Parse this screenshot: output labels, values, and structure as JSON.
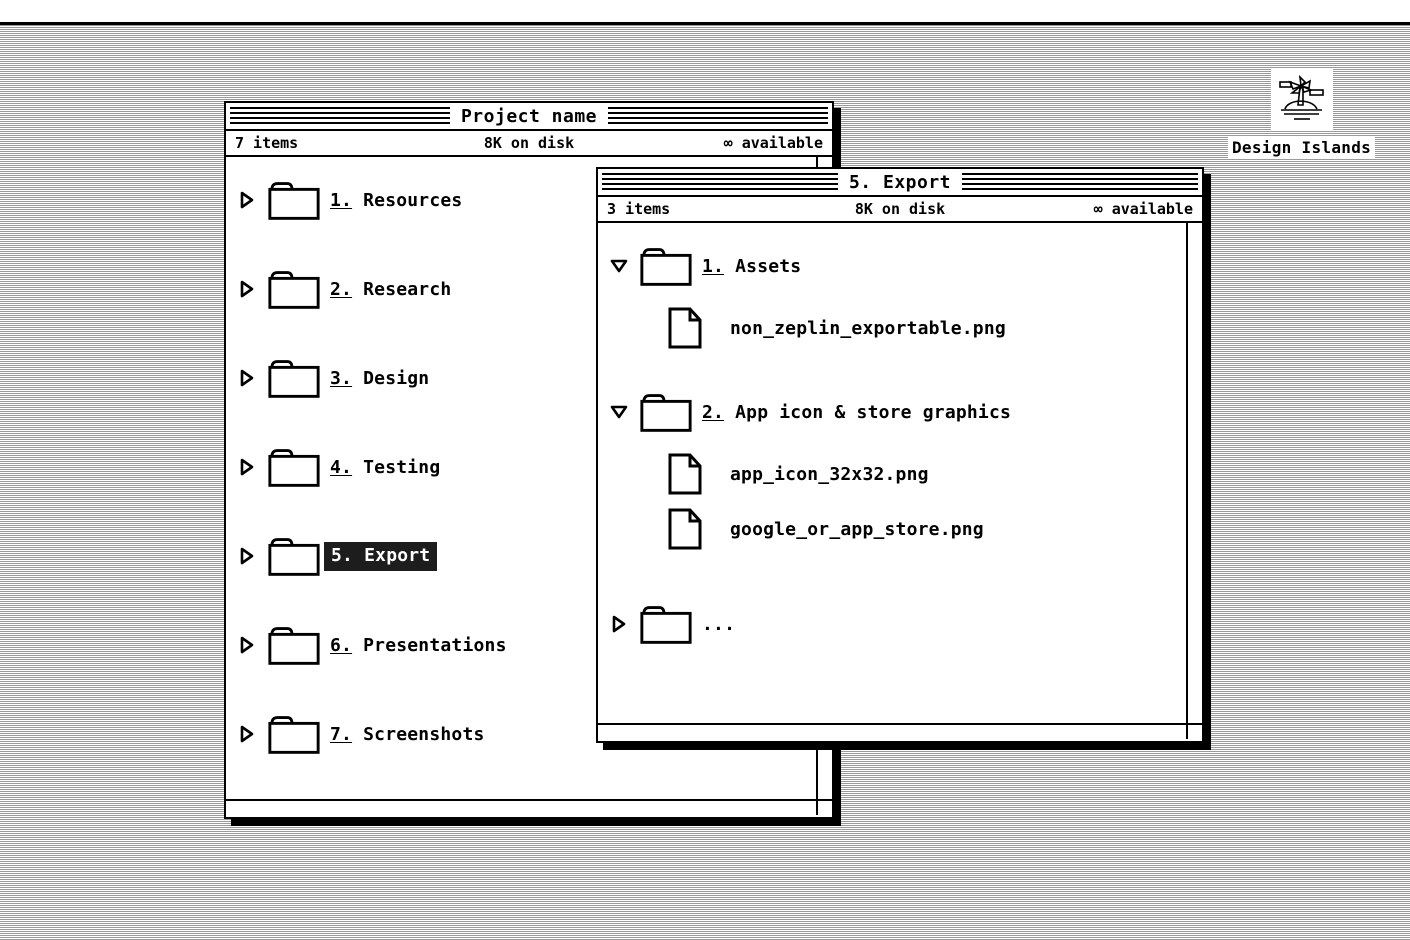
{
  "menubar": {
    "label": ""
  },
  "logo": {
    "icon": "palm-island-icon",
    "caption": "Design Islands"
  },
  "windows": [
    {
      "id": "project-window",
      "title": "Project name",
      "info": {
        "items": "7 items",
        "disk": "8K on disk",
        "available": "∞ available"
      },
      "rows": [
        {
          "twisty": "collapsed",
          "icon": "folder-icon",
          "num": "1.",
          "name": "Resources",
          "selected": false
        },
        {
          "twisty": "collapsed",
          "icon": "folder-icon",
          "num": "2.",
          "name": "Research",
          "selected": false
        },
        {
          "twisty": "collapsed",
          "icon": "folder-icon",
          "num": "3.",
          "name": "Design",
          "selected": false
        },
        {
          "twisty": "collapsed",
          "icon": "folder-icon",
          "num": "4.",
          "name": "Testing",
          "selected": false
        },
        {
          "twisty": "collapsed",
          "icon": "folder-icon",
          "num": "5.",
          "name": "Export",
          "selected": true
        },
        {
          "twisty": "collapsed",
          "icon": "folder-icon",
          "num": "6.",
          "name": "Presentations",
          "selected": false
        },
        {
          "twisty": "collapsed",
          "icon": "folder-icon",
          "num": "7.",
          "name": "Screenshots",
          "selected": false
        }
      ]
    },
    {
      "id": "export-window",
      "title": "5. Export",
      "info": {
        "items": "3 items",
        "disk": "8K on disk",
        "available": "∞ available"
      },
      "rows": [
        {
          "twisty": "expanded",
          "icon": "folder-icon",
          "num": "1.",
          "name": "Assets",
          "indent": 0
        },
        {
          "twisty": "none",
          "icon": "file-icon",
          "num": "",
          "name": "non_zeplin_exportable.png",
          "indent": 1
        },
        {
          "twisty": "expanded",
          "icon": "folder-icon",
          "num": "2.",
          "name": "App icon & store graphics",
          "indent": 0
        },
        {
          "twisty": "none",
          "icon": "file-icon",
          "num": "",
          "name": "app_icon_32x32.png",
          "indent": 1
        },
        {
          "twisty": "none",
          "icon": "file-icon",
          "num": "",
          "name": "google_or_app_store.png",
          "indent": 1
        },
        {
          "twisty": "collapsed",
          "icon": "folder-icon",
          "num": "",
          "name": "...",
          "indent": 0
        }
      ]
    }
  ],
  "colors": {
    "ink": "#000000",
    "paper": "#ffffff",
    "selection_bg": "#1d1d1d",
    "selection_fg": "#ffffff"
  }
}
